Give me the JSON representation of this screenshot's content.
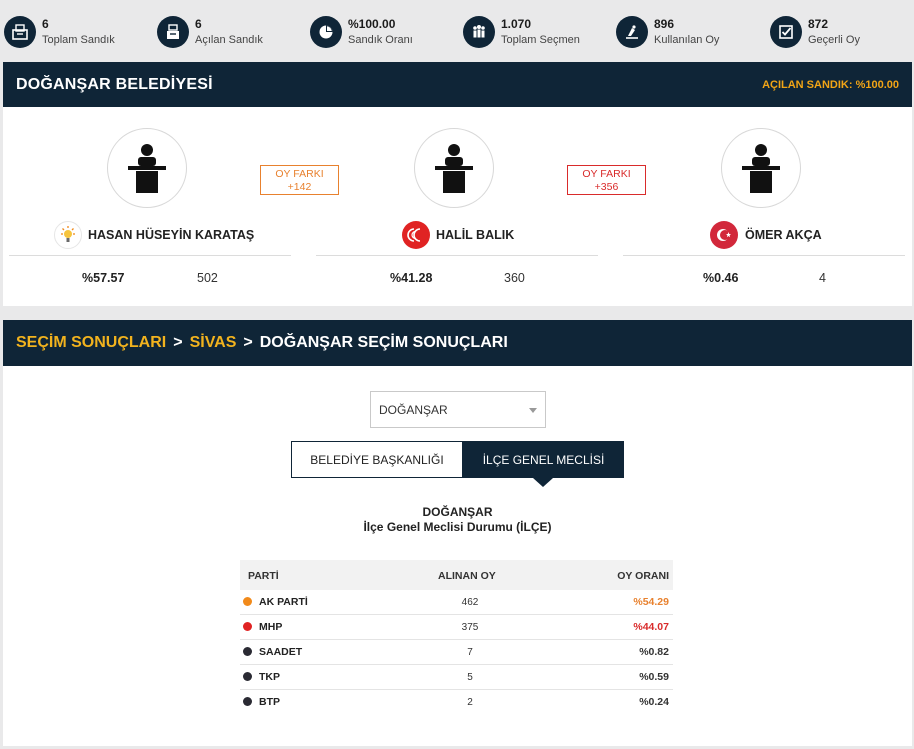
{
  "stats": [
    {
      "value": "6",
      "label": "Toplam Sandık",
      "icon": "ballot-box-icon"
    },
    {
      "value": "6",
      "label": "Açılan Sandık",
      "icon": "open-ballot-box-icon"
    },
    {
      "value": "%100.00",
      "label": "Sandık Oranı",
      "icon": "pie-chart-icon"
    },
    {
      "value": "1.070",
      "label": "Toplam Seçmen",
      "icon": "people-icon"
    },
    {
      "value": "896",
      "label": "Kullanılan Oy",
      "icon": "vote-cast-icon"
    },
    {
      "value": "872",
      "label": "Geçerli Oy",
      "icon": "check-square-icon"
    }
  ],
  "municipality": {
    "title": "DOĞANŞAR BELEDİYESİ",
    "opened_ratio": "AÇILAN SANDIK: %100.00"
  },
  "candidates": [
    {
      "name": "HASAN HÜSEYİN KARATAŞ",
      "percent": "%57.57",
      "votes": "502",
      "party": "AK PARTİ",
      "party_color": "#f18a1b"
    },
    {
      "name": "HALİL BALIK",
      "percent": "%41.28",
      "votes": "360",
      "party": "MHP",
      "party_color": "#e02323"
    },
    {
      "name": "ÖMER AKÇA",
      "percent": "%0.46",
      "votes": "4",
      "party": "BTP",
      "party_color": "#d2283b"
    }
  ],
  "vote_diffs": [
    {
      "label": "OY FARKI",
      "value": "+142",
      "color": "#e8812e"
    },
    {
      "label": "OY FARKI",
      "value": "+356",
      "color": "#d92b2b"
    }
  ],
  "breadcrumb": {
    "items": [
      "SEÇİM SONUÇLARI",
      "SİVAS",
      "DOĞANŞAR SEÇİM SONUÇLARI"
    ],
    "separator": ">"
  },
  "selector": {
    "value": "DOĞANŞAR"
  },
  "tabs": [
    {
      "label": "BELEDİYE BAŞKANLIĞI",
      "active": false
    },
    {
      "label": "İLÇE GENEL MECLİSİ",
      "active": true
    }
  ],
  "results": {
    "title": "DOĞANŞAR",
    "subtitle": "İlçe Genel Meclisi Durumu (İLÇE)",
    "columns": [
      "PARTİ",
      "ALINAN OY",
      "OY ORANI"
    ],
    "rows": [
      {
        "party": "AK PARTİ",
        "votes": "462",
        "ratio": "%54.29",
        "color": "#f18a1b",
        "ratio_color": "#e8812e"
      },
      {
        "party": "MHP",
        "votes": "375",
        "ratio": "%44.07",
        "color": "#e02323",
        "ratio_color": "#d92b2b"
      },
      {
        "party": "SAADET",
        "votes": "7",
        "ratio": "%0.82",
        "color": "#2a2a33",
        "ratio_color": "#333333"
      },
      {
        "party": "TKP",
        "votes": "5",
        "ratio": "%0.59",
        "color": "#2a2a33",
        "ratio_color": "#333333"
      },
      {
        "party": "BTP",
        "votes": "2",
        "ratio": "%0.24",
        "color": "#2a2a33",
        "ratio_color": "#333333"
      }
    ]
  },
  "colors": {
    "navy": "#0f2537",
    "accent": "#f2b31e"
  }
}
